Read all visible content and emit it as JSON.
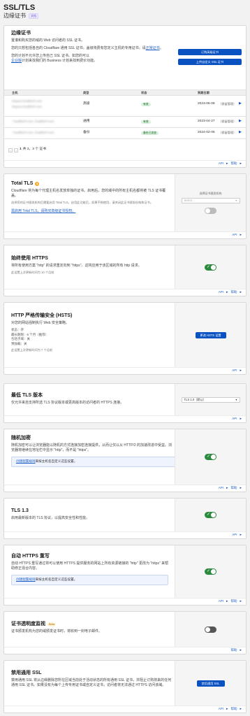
{
  "page": {
    "title": "SSL/TLS",
    "subtitle": "边缘证书",
    "doc_badge": "文档"
  },
  "edge_certs": {
    "title": "边缘证书",
    "desc1": "置灌和购买您的域的 Web 访问者的 SSL 证书。",
    "desc2a": "您的只想包括各自的 Cloudflare 通用 SSL 证书。盖级将费有您定义主机的专用证书。请",
    "desc2_link": "正常证书",
    "desc2b": "。",
    "desc3a": "您的计划不允许您上传自己 SSL 证书。如您的可以",
    "desc3_link": "企业版",
    "desc3b": "计划来找我们的 Business 计划来找到费价功能。",
    "btn_order": "订购高级证书",
    "btn_upload": "上传自定义 SSL 证书",
    "columns": [
      "主机",
      "类型",
      "状态",
      "到期日期"
    ],
    "rows": [
      {
        "host1": "hispeer.healthKP.com",
        "host2": "hispeer.healthKP.com",
        "type": "高级",
        "status": "有效",
        "expiry": "2023-06-08",
        "note": "（保留管理）"
      },
      {
        "host1": "*.healthKP.com, healthKP.com",
        "host2": "",
        "type": "通用",
        "status": "有效",
        "expiry": "2023-04-27",
        "note": "（保留管理）"
      },
      {
        "host1": "*.healthKP.com, healthKP.com",
        "host2": "",
        "type": "备份",
        "status": "备份已发放",
        "expiry": "2024-02-05",
        "note": "（保留管理）"
      }
    ],
    "pager": {
      "page": "1",
      "text": "共 3，3 个 证书"
    }
  },
  "footer": {
    "api": "API",
    "help": "帮助"
  },
  "total_tls": {
    "title": "Total TLS",
    "desc": "Cloudflare 将为每个代理主机名发放单独的证书。启用后，您的域中的所有主机名都将被 TLS 证书覆盖。",
    "note": "选择您的证书颁发机构后需要启用 Total TLS。启用此功能后，如果不想使用，请关闭此证书颁发机构和证书。",
    "link": "需启用 Total TLS，请购买高级证书授权。",
    "select_label": "选择证书颁发机构",
    "select_placeholder": "Select..."
  },
  "always_https": {
    "title": "始终使用 HTTPS",
    "desc": "将所有使用方案 \"http\" 的请求重定向到 \"https\"。这将应用于该区域的所有 http 请求。",
    "note": "此设置上次更新时间为 10 个月前"
  },
  "hsts": {
    "title": "HTTP 严格传输安全 (HSTS)",
    "desc": "对您的网站强制执行 Web 安全策略。",
    "lines": [
      "状态：开",
      "最长期限：6 个月（推荐）",
      "包括子域：关",
      "预加载：关"
    ],
    "note": "此设置上次更新时间为 7 个月前",
    "btn": "更改 HSTS 设置"
  },
  "min_tls": {
    "title": "最低 TLS 版本",
    "desc": "仅允许来自支持所选 TLS 协议版本或更高版本的访问者的 HTTPS 连接。",
    "value": "TLS 1.0（默认）"
  },
  "random": {
    "title": "随机加密",
    "desc": "随机加密可以让浏览器能以随机的方式连接加密连接提供，从而让仅以从 HTTP/2 的加速改进中受益。浏览器将继续在地址栏中显示 \"http\"，而不是 \"https\"。",
    "info_link": "创建配置规则",
    "info_text": "来按主机名自定义这些设置。"
  },
  "tls13": {
    "title": "TLS 1.3",
    "desc": "启用最新版本的 TLS 协议，以提高安全性和性能。"
  },
  "auto_rewrite": {
    "title": "自动 HTTPS 重写",
    "desc": "自动 HTTPS 重写通过将可以使用 HTTPS 提供服务的网站上所有资源链接的 \"http\" 更改为 \"https\" 来帮助修正混合内容。",
    "info_link": "创建配置规则",
    "info_text": "来按主机名自定义这些设置。"
  },
  "ct_monitor": {
    "title": "证书透明度监视",
    "beta": "Beta",
    "desc": "证书颁发机构为您的域颁发证书时，将收到一封电子邮件。"
  },
  "disable_universal": {
    "title": "禁用通用 SSL",
    "desc": "禁用通用 SSL 将从边缘删除您所在区域当前处于活动状态的所有通用 SSL 证书，并阻止订购将来的任何通用 SSL 证书。如果没有为每个上传专用证书或自定义证书，访问者将无法通过 HTTPS 访问该域。",
    "btn": "禁用通用 SSL"
  }
}
